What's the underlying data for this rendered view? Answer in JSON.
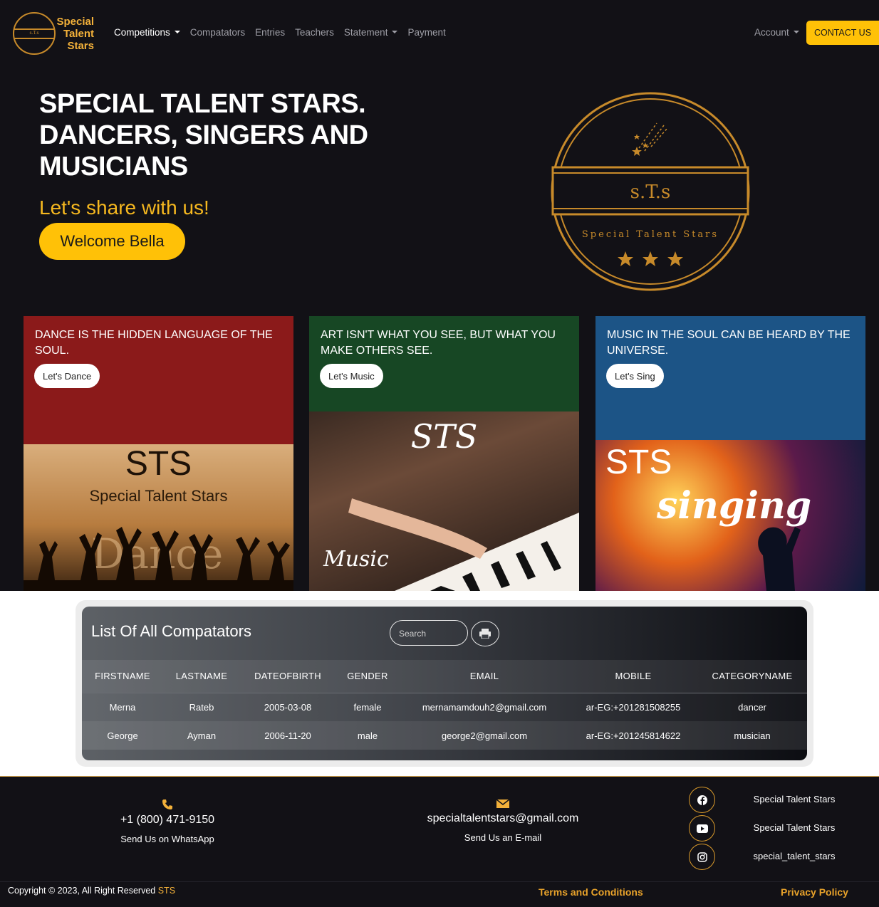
{
  "nav": {
    "logo_text": [
      "Special",
      "Talent",
      "Stars"
    ],
    "logo_inner": "s.T.s",
    "links": [
      {
        "label": "Competitions",
        "dropdown": true,
        "active": true
      },
      {
        "label": "Compatators",
        "dropdown": false
      },
      {
        "label": "Entries",
        "dropdown": false
      },
      {
        "label": "Teachers",
        "dropdown": false
      },
      {
        "label": "Statement",
        "dropdown": true
      },
      {
        "label": "Payment",
        "dropdown": false
      }
    ],
    "account": "Account",
    "contact": "CONTACT US"
  },
  "hero": {
    "title_lines": [
      "SPECIAL TALENT STARS.",
      "DANCERS, SINGERS AND",
      "MUSICIANS"
    ],
    "subtitle": "Let's share with us!",
    "welcome_button": "Welcome Bella",
    "seal_top": "s.T.s",
    "seal_bottom": "Special Talent Stars"
  },
  "cards": [
    {
      "quote": "DANCE IS THE HIDDEN LANGUAGE OF THE SOUL.",
      "button": "Let's Dance",
      "color": "#8b1a1a",
      "img_title": "STS",
      "img_subtitle": "Special Talent Stars",
      "img_word": "Dance"
    },
    {
      "quote": "ART ISN'T WHAT YOU SEE, BUT WHAT YOU MAKE OTHERS SEE.",
      "button": "Let's Music",
      "color": "#174724",
      "img_title": "STS",
      "img_word": "Music"
    },
    {
      "quote": "MUSIC IN THE SOUL CAN BE HEARD BY THE UNIVERSE.",
      "button": "Let's Sing",
      "color": "#1c5486",
      "img_title": "STS",
      "img_word": "singing"
    }
  ],
  "table": {
    "title": "List Of All Compatators",
    "search_placeholder": "Search",
    "headers": [
      "FIRSTNAME",
      "LASTNAME",
      "DATEOFBIRTH",
      "GENDER",
      "EMAIL",
      "MOBILE",
      "CATEGORYNAME"
    ],
    "rows": [
      [
        "Merna",
        "Rateb",
        "2005-03-08",
        "female",
        "mernamamdouh2@gmail.com",
        "ar-EG:+201281508255",
        "dancer"
      ],
      [
        "George",
        "Ayman",
        "2006-11-20",
        "male",
        "george2@gmail.com",
        "ar-EG:+201245814622",
        "musician"
      ]
    ]
  },
  "footer": {
    "phone": "+1 (800) 471-9150",
    "phone_label": "Send Us on WhatsApp",
    "email": "specialtalentstars@gmail.com",
    "email_label": "Send Us an E-mail",
    "socials": [
      {
        "icon": "facebook-icon",
        "label": "Special Talent Stars"
      },
      {
        "icon": "youtube-icon",
        "label": "Special Talent Stars"
      },
      {
        "icon": "instagram-icon",
        "label": "special_talent_stars"
      }
    ],
    "copyright": "Copyright © 2023, All Right Reserved",
    "copyright_brand": "STS",
    "terms": "Terms and Conditions",
    "privacy": "Privacy Policy"
  },
  "colors": {
    "accent": "#ffc107",
    "gold": "#c78a2a",
    "dark": "#121116"
  }
}
